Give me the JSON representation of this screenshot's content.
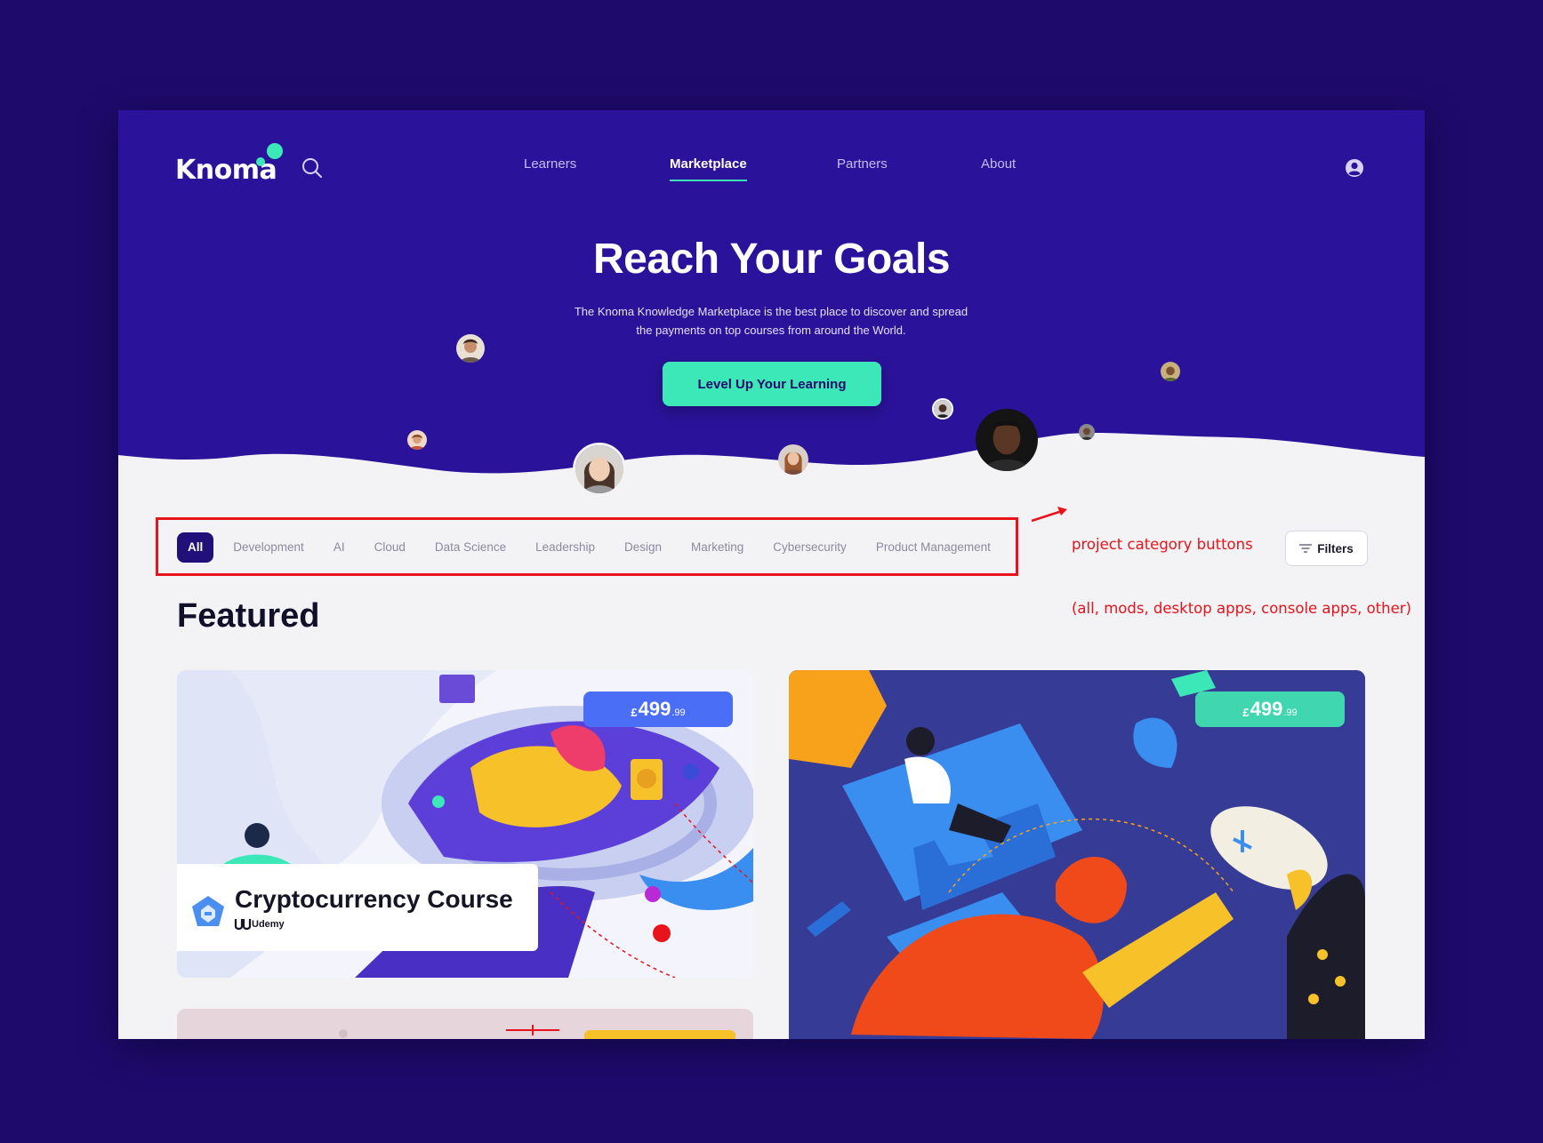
{
  "brand": {
    "name": "Knoma"
  },
  "nav": {
    "items": [
      {
        "label": "Learners"
      },
      {
        "label": "Marketplace",
        "active": true
      },
      {
        "label": "Partners"
      },
      {
        "label": "About"
      }
    ]
  },
  "hero": {
    "title": "Reach Your Goals",
    "subtitle_line1": "The Knoma Knowledge Marketplace is the best place to discover and spread",
    "subtitle_line2": "the payments on top courses from around the World.",
    "cta_label": "Level Up Your Learning"
  },
  "categories": {
    "items": [
      "All",
      "Development",
      "AI",
      "Cloud",
      "Data Science",
      "Leadership",
      "Design",
      "Marketing",
      "Cybersecurity",
      "Product Management"
    ],
    "active": "All",
    "filters_label": "Filters"
  },
  "annotation": {
    "line1": "project category buttons",
    "line2": "(all, mods, desktop apps, console apps, other)"
  },
  "featured": {
    "heading": "Featured",
    "cards": [
      {
        "title": "Cryptocurrency Course",
        "provider": "Udemy",
        "price_currency": "£",
        "price_main": "499",
        "price_cents": ".99",
        "price_color": "#4a6ef5"
      },
      {
        "title": "",
        "provider": "",
        "price_currency": "£",
        "price_main": "499",
        "price_cents": ".99",
        "price_color": "#3fd6b0"
      }
    ]
  },
  "colors": {
    "brand_bg": "#2a139a",
    "outer_bg": "#1d0a6b",
    "accent": "#3de8b8",
    "annotation": "#e8131b"
  }
}
